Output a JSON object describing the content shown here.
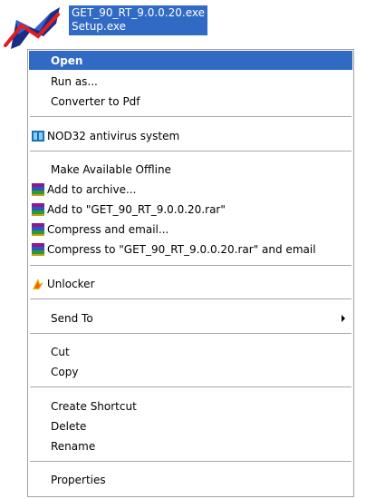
{
  "file": {
    "name_line1": "GET_90_RT_9.0.0.20.exe",
    "name_line2": "Setup.exe"
  },
  "menu": {
    "open": "Open",
    "run_as": "Run as...",
    "converter_pdf": "Converter to Pdf",
    "nod32": "NOD32 antivirus system",
    "make_offline": "Make Available Offline",
    "add_archive": "Add to archive...",
    "add_rar": "Add to \"GET_90_RT_9.0.0.20.rar\"",
    "compress_email": "Compress and email...",
    "compress_rar_email": "Compress to \"GET_90_RT_9.0.0.20.rar\" and email",
    "unlocker": "Unlocker",
    "send_to": "Send To",
    "cut": "Cut",
    "copy": "Copy",
    "create_shortcut": "Create Shortcut",
    "delete": "Delete",
    "rename": "Rename",
    "properties": "Properties"
  },
  "colors": {
    "selection": "#316ac5",
    "separator": "#a7a7a7"
  },
  "icons": {
    "file": "installer-file-icon",
    "nod32": "nod32-icon",
    "winrar": "winrar-icon",
    "unlocker": "unlocker-icon",
    "submenu": "submenu-arrow-icon"
  }
}
